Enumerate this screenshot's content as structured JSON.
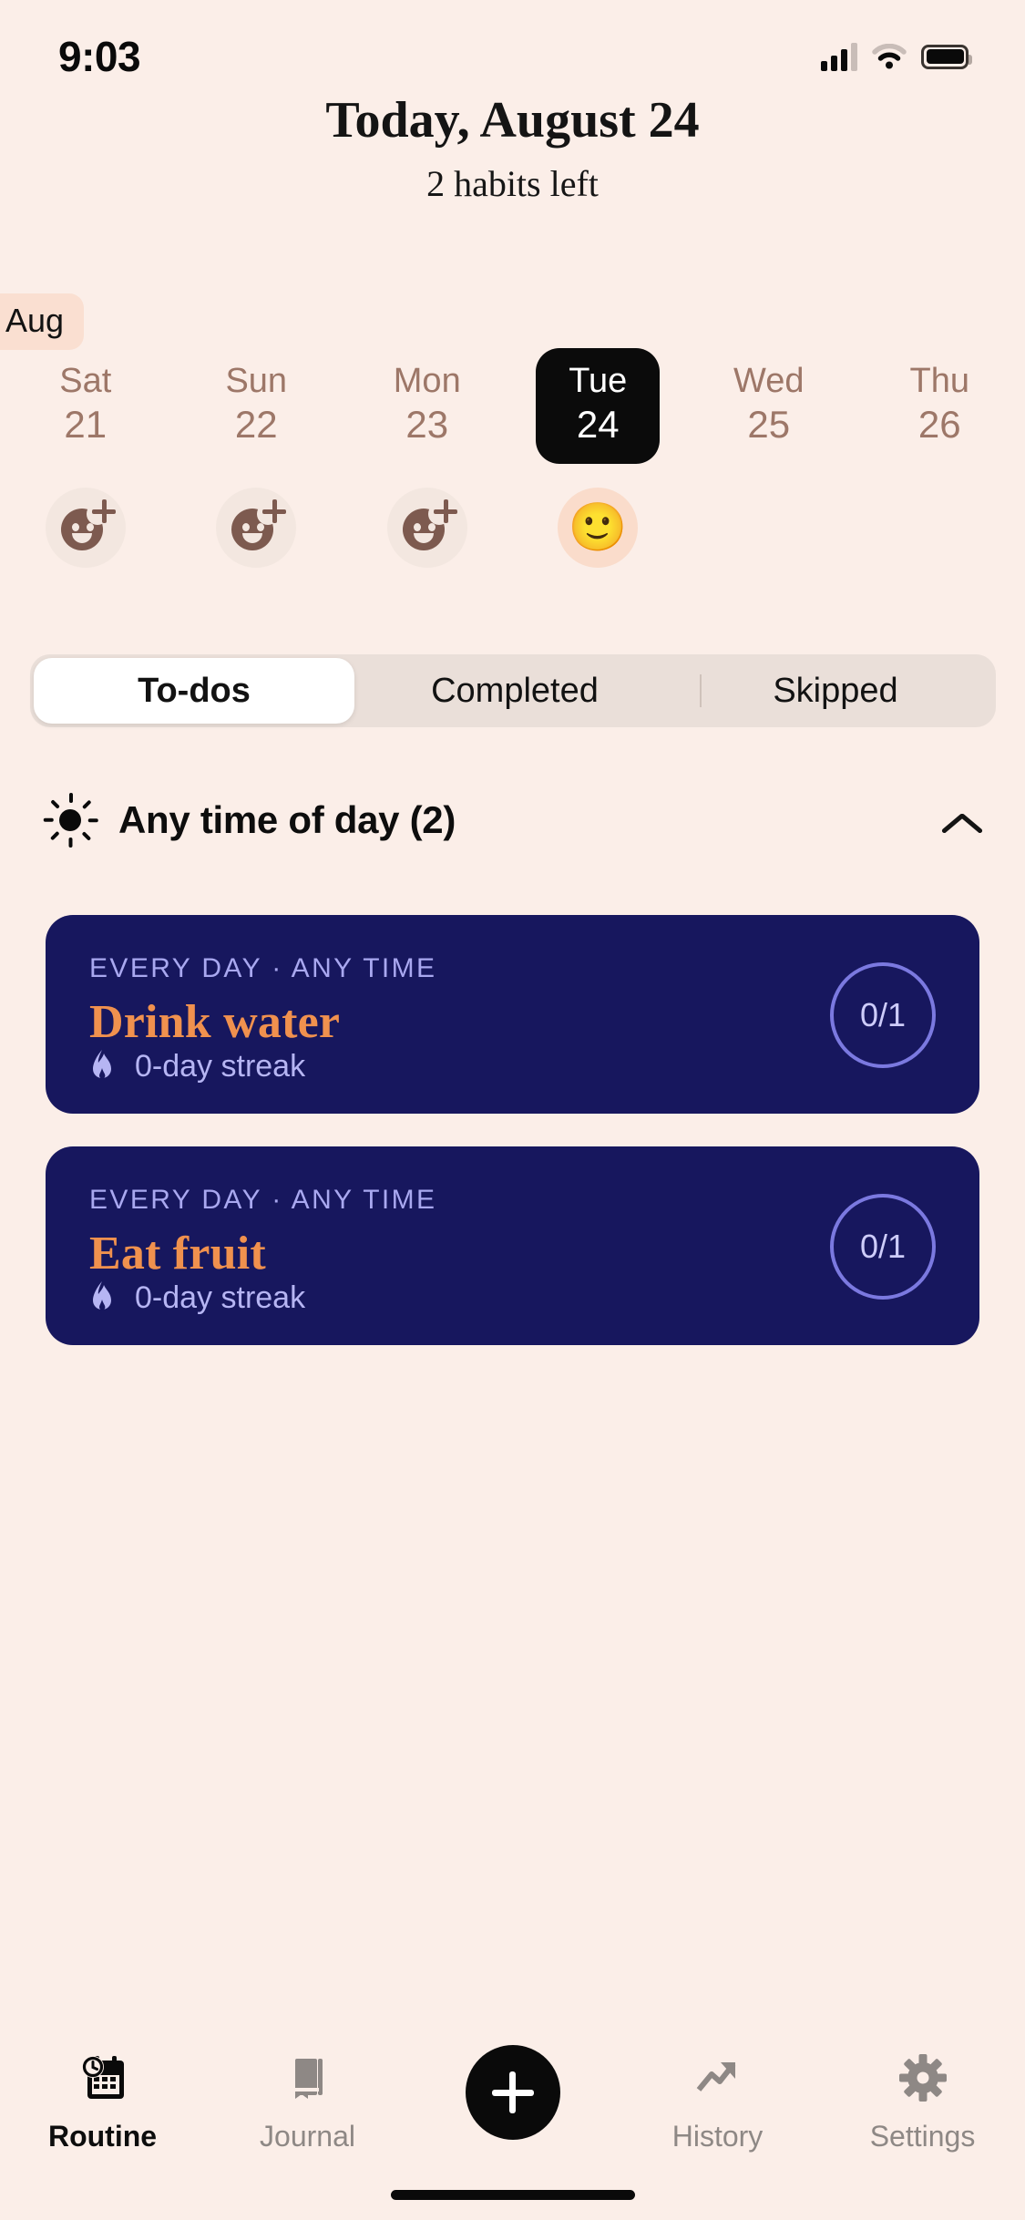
{
  "status_bar": {
    "time": "9:03",
    "cellular_icon": "cellular-signal-icon",
    "wifi_icon": "wifi-icon",
    "battery_icon": "battery-icon"
  },
  "header": {
    "title": "Today, August 24",
    "subtitle": "2 habits left"
  },
  "calendar": {
    "month_badge": "Aug",
    "days": [
      {
        "dow": "Sat",
        "date": "21",
        "selected": false,
        "mood": "add-mood",
        "mood_emoji": ""
      },
      {
        "dow": "Sun",
        "date": "22",
        "selected": false,
        "mood": "add-mood",
        "mood_emoji": ""
      },
      {
        "dow": "Mon",
        "date": "23",
        "selected": false,
        "mood": "add-mood",
        "mood_emoji": ""
      },
      {
        "dow": "Tue",
        "date": "24",
        "selected": true,
        "mood": "neutral-face",
        "mood_emoji": "🙂"
      },
      {
        "dow": "Wed",
        "date": "25",
        "selected": false,
        "mood": "none",
        "mood_emoji": ""
      },
      {
        "dow": "Thu",
        "date": "26",
        "selected": false,
        "mood": "none",
        "mood_emoji": ""
      }
    ]
  },
  "tabs": {
    "items": [
      {
        "label": "To-dos",
        "active": true
      },
      {
        "label": "Completed",
        "active": false
      },
      {
        "label": "Skipped",
        "active": false
      }
    ]
  },
  "section": {
    "icon": "sun-icon",
    "title": "Any time of day (2)",
    "collapse_icon": "chevron-up-icon"
  },
  "habits": [
    {
      "meta": "EVERY DAY · ANY TIME",
      "title": "Drink water",
      "streak": "0-day streak",
      "streak_icon": "flame-icon",
      "progress": "0/1"
    },
    {
      "meta": "EVERY DAY · ANY TIME",
      "title": "Eat fruit",
      "streak": "0-day streak",
      "streak_icon": "flame-icon",
      "progress": "0/1"
    }
  ],
  "bottom_nav": {
    "items": [
      {
        "label": "Routine",
        "icon": "calendar-clock-icon",
        "active": true
      },
      {
        "label": "Journal",
        "icon": "book-icon",
        "active": false
      },
      {
        "label": "",
        "icon": "plus-icon",
        "active": false
      },
      {
        "label": "History",
        "icon": "trending-up-icon",
        "active": false
      },
      {
        "label": "Settings",
        "icon": "gear-icon",
        "active": false
      }
    ]
  },
  "colors": {
    "background": "#fbeee8",
    "card_navy": "#17175e",
    "accent_orange": "#f0914e",
    "muted_brown": "#9d7768",
    "badge_peach": "#fadfd1",
    "periwinkle": "#a9a8f0"
  }
}
